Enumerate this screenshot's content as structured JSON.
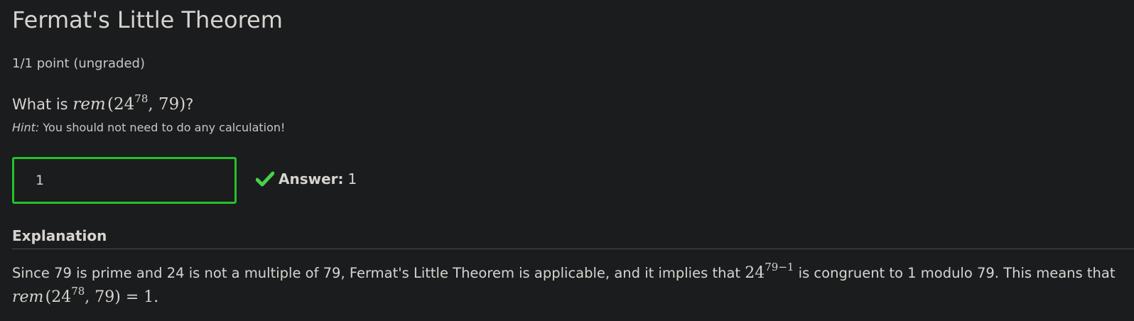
{
  "problem": {
    "title": "Fermat's Little Theorem",
    "score": "1/1 point (ungraded)",
    "question_prefix": "What is",
    "question_suffix": "?",
    "question_math": {
      "fn": "rem",
      "open": "(24",
      "exp": "78",
      "rest": ", 79)"
    },
    "hint_label": "Hint:",
    "hint_text": "You should not need to do any calculation!"
  },
  "answer": {
    "input_value": "1",
    "status_icon": "checkmark-icon",
    "status_color": "#47d14a",
    "input_border_color": "#26c02a",
    "label": "Answer:",
    "value": "1"
  },
  "explanation": {
    "heading": "Explanation",
    "text_1": "Since 79 is prime and 24 is not a multiple of 79, Fermat's Little Theorem is applicable, and it implies that ",
    "math_1_base": "24",
    "math_1_exp": "79−1",
    "text_2": " is congruent to 1 modulo 79. This means that",
    "math_2": {
      "fn": "rem",
      "open": "(24",
      "exp": "78",
      "rest": ", 79) = 1."
    }
  }
}
